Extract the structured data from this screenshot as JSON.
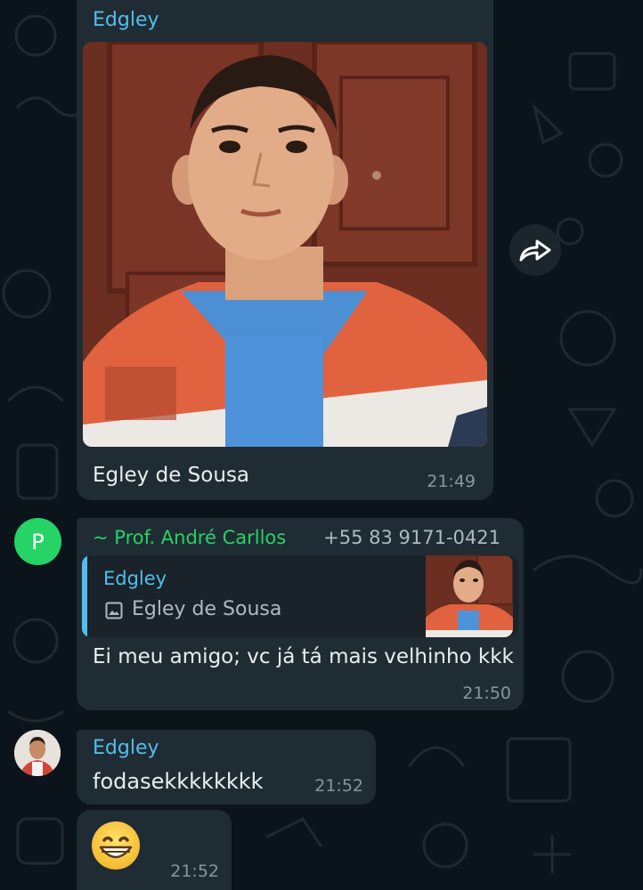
{
  "colors": {
    "background": "#0b141a",
    "bubble": "#202c33",
    "sender_blue": "#53bdeb",
    "sender_green": "#25d366",
    "meta_gray": "#8696a0"
  },
  "messages": [
    {
      "sender": "Edgley",
      "type": "image",
      "image_icon": "selfie-photo",
      "caption": "Egley de Sousa",
      "time": "21:49"
    },
    {
      "sender": "~ Prof. André Carllos",
      "phone": "+55 83 9171-0421",
      "avatar_letter": "P",
      "quote": {
        "sender": "Edgley",
        "icon": "image-icon",
        "text": "Egley de Sousa"
      },
      "text": "Ei meu amigo; vc já tá mais velhinho kkk",
      "time": "21:50"
    },
    {
      "sender": "Edgley",
      "text": "fodasekkkkkkkk",
      "time": "21:52"
    },
    {
      "emoji": "grinning-face-icon",
      "time": "21:52"
    }
  ],
  "forward_icon": "forward-arrow-icon"
}
